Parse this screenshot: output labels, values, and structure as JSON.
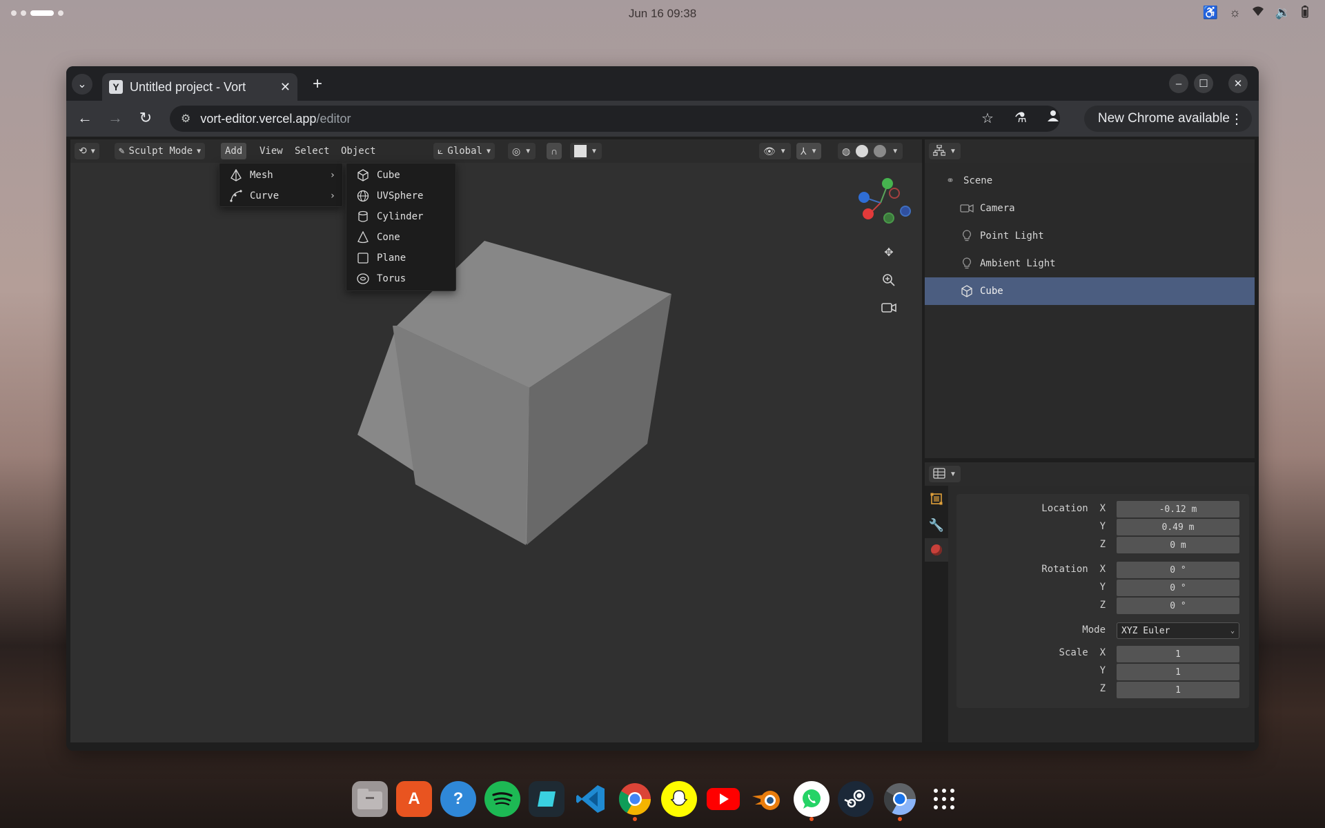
{
  "system": {
    "clock": "Jun 16  09:38"
  },
  "browser": {
    "tab_title": "Untitled project - Vort",
    "url_host": "vort-editor.vercel.app",
    "url_path": "/editor",
    "update_label": "New Chrome available"
  },
  "viewport": {
    "mode_label": "Sculpt Mode",
    "menus": [
      "Add",
      "View",
      "Select",
      "Object"
    ],
    "transform_orientation": "Global"
  },
  "add_menu": {
    "items": [
      "Mesh",
      "Curve"
    ]
  },
  "mesh_submenu": {
    "items": [
      "Cube",
      "UVSphere",
      "Cylinder",
      "Cone",
      "Plane",
      "Torus"
    ]
  },
  "outliner": {
    "items": [
      "Scene",
      "Camera",
      "Point Light",
      "Ambient Light",
      "Cube"
    ],
    "selected": "Cube"
  },
  "properties": {
    "location_label": "Location",
    "rotation_label": "Rotation",
    "mode_label": "Mode",
    "scale_label": "Scale",
    "axis_x": "X",
    "axis_y": "Y",
    "axis_z": "Z",
    "location": {
      "x": "-0.12 m",
      "y": "0.49 m",
      "z": "0 m"
    },
    "rotation": {
      "x": "0 °",
      "y": "0 °",
      "z": "0 °"
    },
    "rotation_mode": "XYZ Euler",
    "scale": {
      "x": "1",
      "y": "1",
      "z": "1"
    }
  },
  "colors": {
    "selection": "#4b5d80",
    "accent": "#e95420"
  },
  "dock": {
    "apps": [
      "files-icon",
      "app-center-icon",
      "help-icon",
      "spotify-icon",
      "terminal-icon",
      "vscode-icon",
      "chrome-icon",
      "snapchat-icon",
      "youtube-icon",
      "blender-icon",
      "whatsapp-icon",
      "steam-icon",
      "chrome-dev-icon",
      "app-grid-icon"
    ]
  }
}
